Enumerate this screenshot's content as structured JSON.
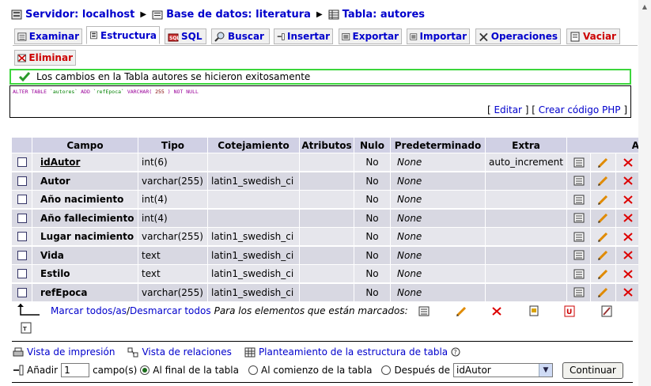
{
  "breadcrumb": {
    "server": "Servidor: localhost",
    "database": "Base de datos: literatura",
    "table": "Tabla: autores"
  },
  "tabs": [
    {
      "label": "Examinar",
      "icon": "browse-icon"
    },
    {
      "label": "Estructura",
      "icon": "structure-icon"
    },
    {
      "label": "SQL",
      "icon": "sql-icon"
    },
    {
      "label": "Buscar",
      "icon": "search-icon"
    },
    {
      "label": "Insertar",
      "icon": "insert-icon"
    },
    {
      "label": "Exportar",
      "icon": "export-icon"
    },
    {
      "label": "Importar",
      "icon": "import-icon"
    },
    {
      "label": "Operaciones",
      "icon": "operations-icon"
    },
    {
      "label": "Vaciar",
      "icon": "empty-icon"
    },
    {
      "label": "Eliminar",
      "icon": "drop-icon"
    }
  ],
  "active_tab": "Estructura",
  "success_message": "Los cambios en la Tabla autores se hicieron exitosamente",
  "sql": {
    "alter": "ALTER TABLE",
    "table": "`autores`",
    "add": "ADD",
    "column": "`refEpoca`",
    "type": "VARCHAR(",
    "size": "255",
    "close": ")",
    "not_null": "NOT NULL",
    "edit_link": "Editar",
    "php_link": "Crear código PHP"
  },
  "table": {
    "headers": [
      "Campo",
      "Tipo",
      "Cotejamiento",
      "Atributos",
      "Nulo",
      "Predeterminado",
      "Extra",
      "A"
    ],
    "rows": [
      {
        "campo": "idAutor",
        "tipo": "int(6)",
        "cotejamiento": "",
        "atributos": "",
        "nulo": "No",
        "predeterminado": "None",
        "extra": "auto_increment",
        "primary": true
      },
      {
        "campo": "Autor",
        "tipo": "varchar(255)",
        "cotejamiento": "latin1_swedish_ci",
        "atributos": "",
        "nulo": "No",
        "predeterminado": "None",
        "extra": ""
      },
      {
        "campo": "Año nacimiento",
        "tipo": "int(4)",
        "cotejamiento": "",
        "atributos": "",
        "nulo": "No",
        "predeterminado": "None",
        "extra": ""
      },
      {
        "campo": "Año fallecimiento",
        "tipo": "int(4)",
        "cotejamiento": "",
        "atributos": "",
        "nulo": "No",
        "predeterminado": "None",
        "extra": ""
      },
      {
        "campo": "Lugar nacimiento",
        "tipo": "varchar(255)",
        "cotejamiento": "latin1_swedish_ci",
        "atributos": "",
        "nulo": "No",
        "predeterminado": "None",
        "extra": ""
      },
      {
        "campo": "Vida",
        "tipo": "text",
        "cotejamiento": "latin1_swedish_ci",
        "atributos": "",
        "nulo": "No",
        "predeterminado": "None",
        "extra": ""
      },
      {
        "campo": "Estilo",
        "tipo": "text",
        "cotejamiento": "latin1_swedish_ci",
        "atributos": "",
        "nulo": "No",
        "predeterminado": "None",
        "extra": ""
      },
      {
        "campo": "refEpoca",
        "tipo": "varchar(255)",
        "cotejamiento": "latin1_swedish_ci",
        "atributos": "",
        "nulo": "No",
        "predeterminado": "None",
        "extra": ""
      }
    ]
  },
  "bulk": {
    "marcar": "Marcar todos/as",
    "separator": " / ",
    "desmarcar": "Desmarcar todos",
    "marked_label": "Para los elementos que están marcados:"
  },
  "footer_links": {
    "print": "Vista de impresión",
    "relations": "Vista de relaciones",
    "propose": "Planteamiento de la estructura de tabla"
  },
  "add_fields": {
    "label": "Añadir",
    "count": "1",
    "campos": "campo(s)",
    "opt_end": "Al final de la tabla",
    "opt_begin": "Al comienzo de la tabla",
    "opt_after": "Después de",
    "after_value": "idAutor",
    "button": "Continuar"
  },
  "colors": {
    "link": "#0000cc",
    "success_border": "#3cd63c",
    "header_bg": "#d0d0e4",
    "row_odd": "#e6e6ec",
    "row_even": "#d8d8e2",
    "danger": "#cc0000"
  }
}
